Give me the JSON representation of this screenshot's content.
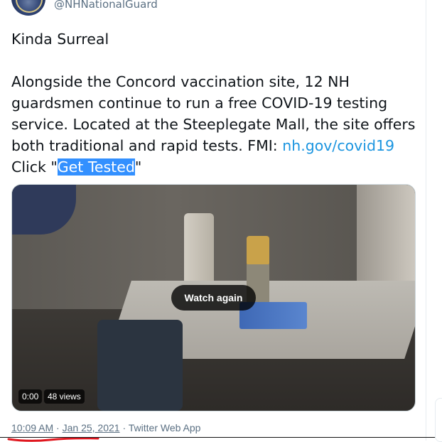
{
  "account": {
    "handle": "@NHNationalGuard"
  },
  "tweet": {
    "title_line": "Kinda Surreal",
    "body_lines": [
      "Alongside the Concord vaccination site, 12 NH",
      "guardsmen continue to run a free COVID-19 testing",
      "service. Located at the Steeplegate Mall, the site offers"
    ],
    "fmi_prefix": "both traditional and rapid tests. FMI: ",
    "fmi_link": "nh.gov/covid19",
    "click_prefix": "Click \"",
    "click_highlight": "Get Tested",
    "click_suffix": "\""
  },
  "video": {
    "watch_again_label": "Watch again",
    "time_badge": "0:00",
    "views_badge": "48 views"
  },
  "meta": {
    "time": "10:09 AM",
    "separator1": " · ",
    "date": "Jan 25, 2021",
    "separator2": " · ",
    "source": "Twitter Web App"
  },
  "colors": {
    "link": "#1b95e0",
    "selection": "#3390ff",
    "annotation_underline": "#e0171f"
  }
}
